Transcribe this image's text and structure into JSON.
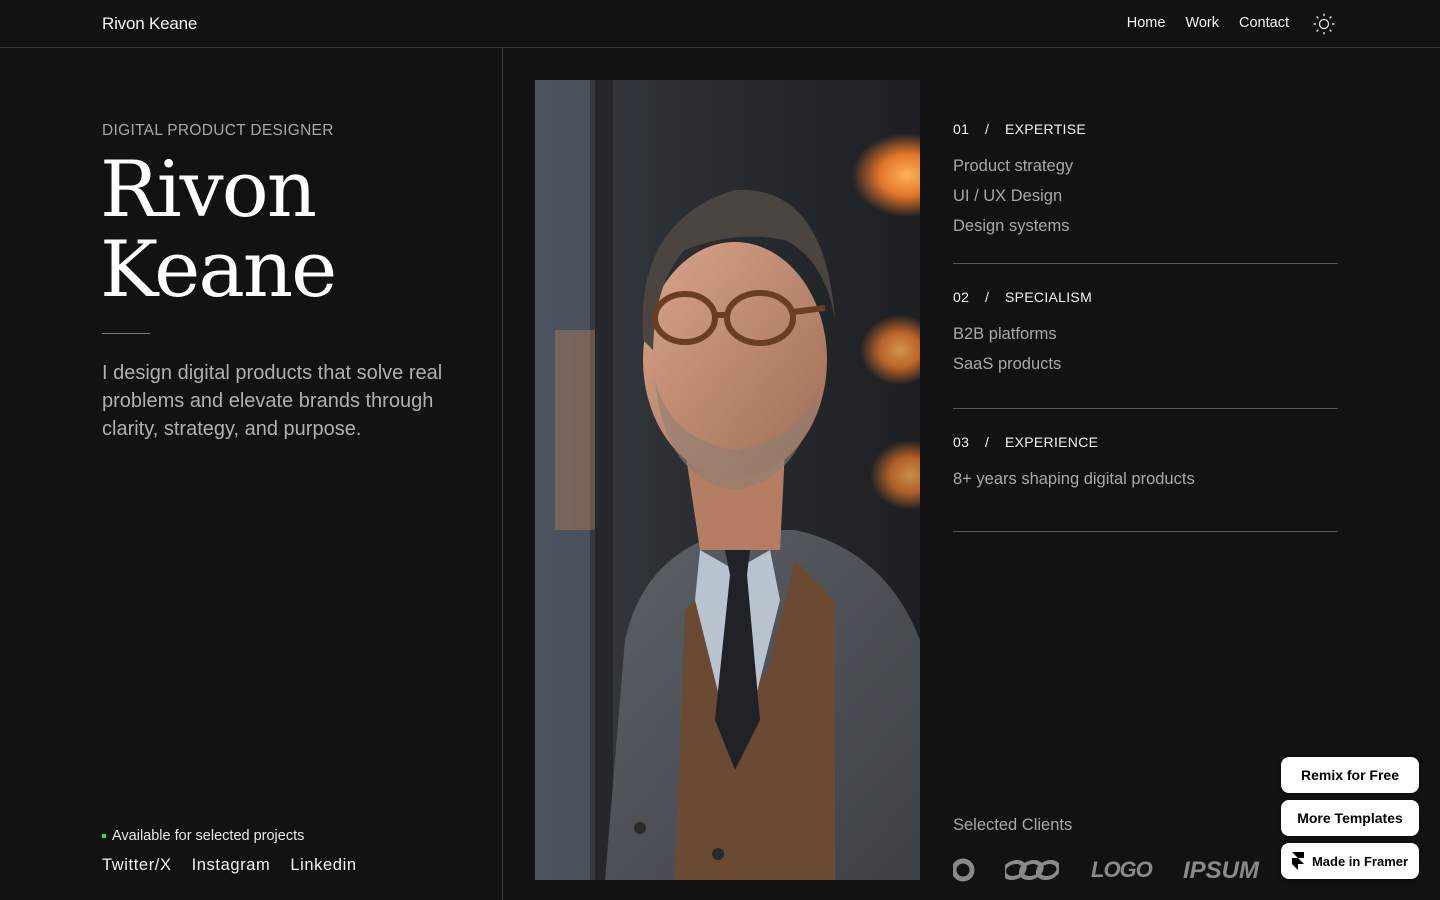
{
  "header": {
    "brand": "Rivon Keane",
    "nav": [
      "Home",
      "Work",
      "Contact"
    ],
    "theme_icon": "sun-icon"
  },
  "hero": {
    "role": "DIGITAL PRODUCT DESIGNER",
    "first_name": "Rivon",
    "last_name": "Keane",
    "intro": "I design digital products that solve real problems and elevate brands through clarity, strategy, and purpose."
  },
  "footer_left": {
    "availability": "Available for selected projects",
    "socials": [
      "Twitter/X",
      "Instagram",
      "Linkedin"
    ]
  },
  "sections": [
    {
      "num": "01",
      "slash": "/",
      "title": "EXPERTISE",
      "items": [
        "Product strategy",
        "UI / UX Design",
        "Design systems"
      ]
    },
    {
      "num": "02",
      "slash": "/",
      "title": "SPECIALISM",
      "items": [
        "B2B platforms",
        "SaaS products"
      ]
    },
    {
      "num": "03",
      "slash": "/",
      "title": "EXPERIENCE",
      "items": [
        "8+ years shaping digital products"
      ]
    }
  ],
  "clients": {
    "label": "Selected Clients",
    "logos": [
      "LOGO",
      "IPSUM"
    ]
  },
  "badges": {
    "remix": "Remix for Free",
    "templates": "More Templates",
    "framer": "Made in Framer"
  },
  "colors": {
    "background": "#121212",
    "accent_dot": "#2ecc71"
  }
}
